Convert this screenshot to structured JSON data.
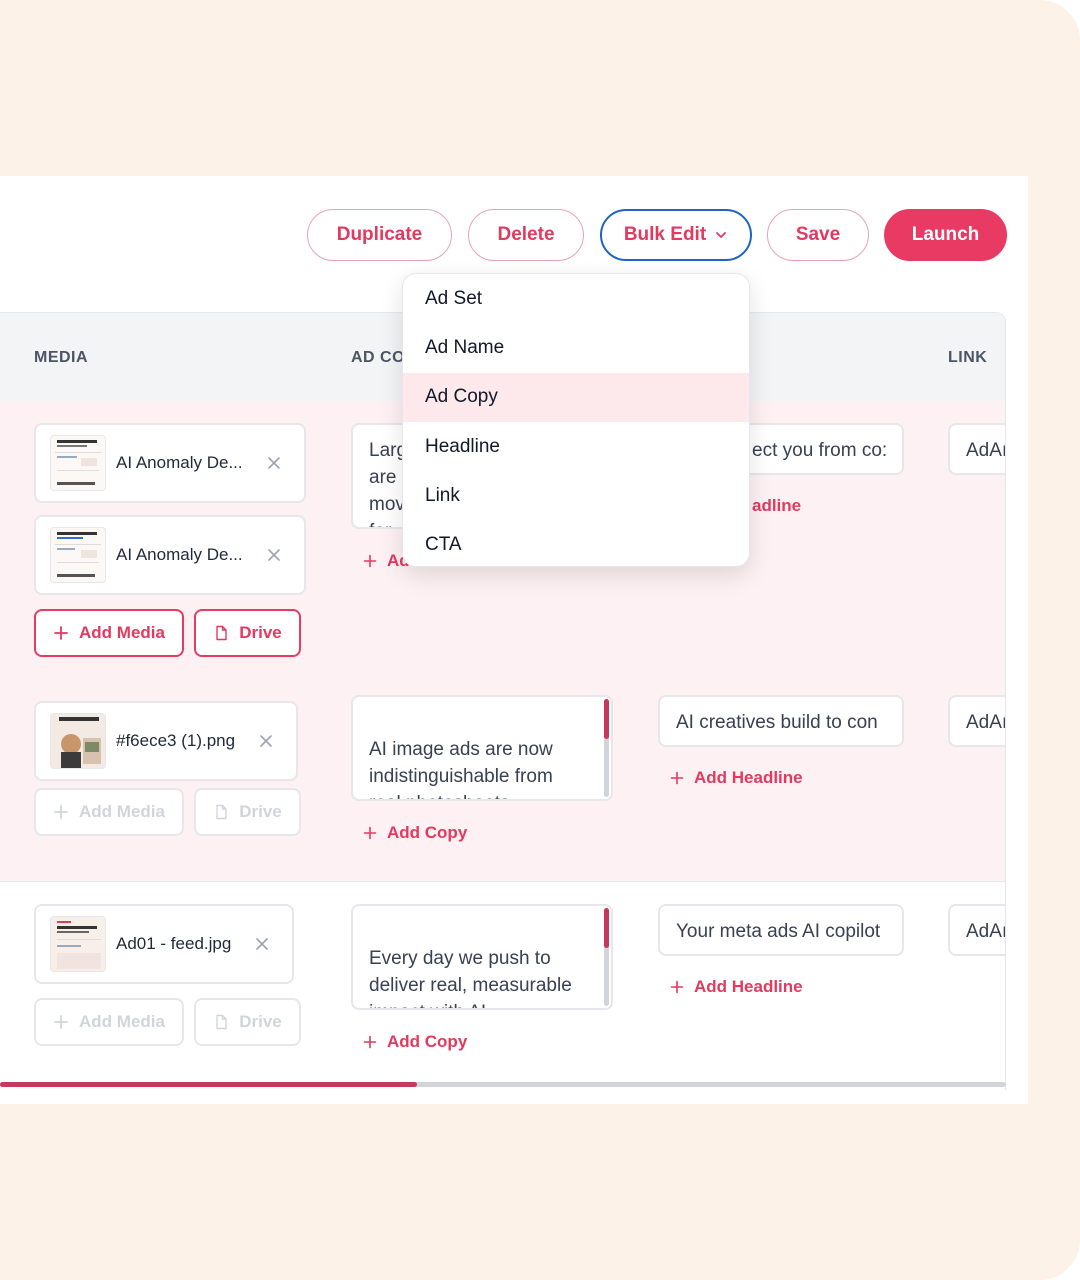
{
  "toolbar": {
    "duplicate": "Duplicate",
    "delete": "Delete",
    "bulk_edit": "Bulk Edit",
    "save": "Save",
    "launch": "Launch"
  },
  "bulk_menu": {
    "items": [
      "Ad Set",
      "Ad Name",
      "Ad Copy",
      "Headline",
      "Link",
      "CTA"
    ],
    "highlighted": "Ad Copy"
  },
  "table": {
    "columns": {
      "media": "MEDIA",
      "ad_copy": "AD CO",
      "link": "LINK"
    },
    "add_media": "Add Media",
    "drive": "Drive",
    "add_copy": "Add Copy",
    "add_headline": "Add Headline",
    "rows": [
      {
        "media": [
          "AI Anomaly De...",
          "AI Anomaly De..."
        ],
        "copy": "Larg\nare\nmov\nfor",
        "headline": "ect you from co:",
        "add_headline_partial": "adline",
        "add_copy_partial": "Ad",
        "link": "AdAı"
      },
      {
        "media": [
          "#f6ece3 (1).png"
        ],
        "copy": "AI image ads are now indistinguishable from real photoshoots.\nAnd the performance",
        "headline": "AI creatives build to con",
        "link": "AdAı"
      },
      {
        "media": [
          "Ad01 - feed.jpg"
        ],
        "copy": "Every day we push to deliver real, measurable impact with AI.",
        "headline": "Your meta ads AI copilot",
        "link": "AdAı"
      }
    ]
  },
  "colors": {
    "accent": "#e83a63",
    "bulk_border": "#1f63c4",
    "row_pink": "#fdf1f4",
    "frame_bg": "#fdf2e7"
  },
  "icons": [
    "plus-icon",
    "file-icon",
    "close-icon",
    "chevron-down-icon"
  ]
}
